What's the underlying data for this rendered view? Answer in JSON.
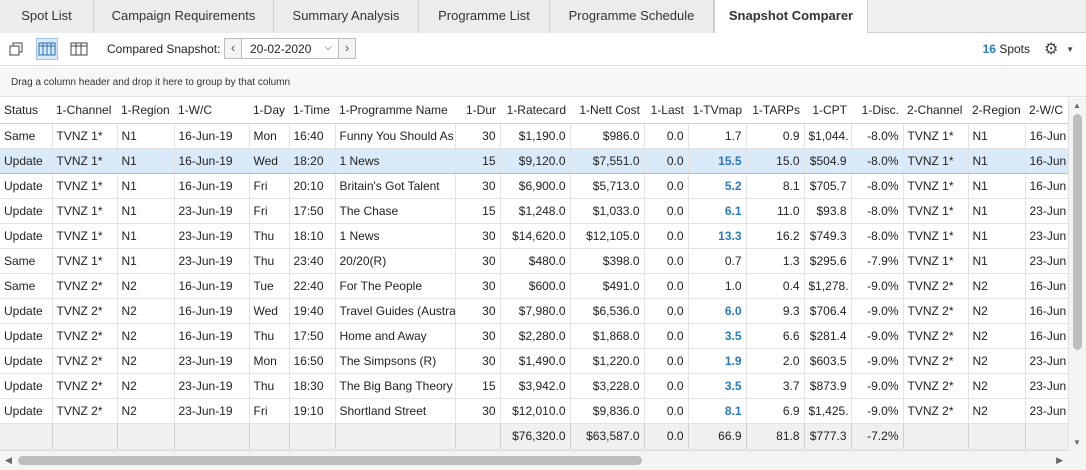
{
  "tabs": [
    {
      "label": "Spot List"
    },
    {
      "label": "Campaign Requirements"
    },
    {
      "label": "Summary Analysis"
    },
    {
      "label": "Programme List"
    },
    {
      "label": "Programme Schedule"
    },
    {
      "label": "Snapshot Comparer"
    }
  ],
  "toolbar": {
    "compared_label": "Compared Snapshot:",
    "snapshot_date": "20-02-2020",
    "spots_count": "16",
    "spots_label": "Spots"
  },
  "group_panel": {
    "hint": "Drag a column header and drop it here to group by that column"
  },
  "grid": {
    "columns": [
      "Status",
      "1-Channel",
      "1-Region",
      "1-W/C",
      "1-Day",
      "1-Time",
      "1-Programme Name",
      "1-Dur",
      "1-Ratecard",
      "1-Nett Cost",
      "1-Last",
      "1-TVmap",
      "1-TARPs",
      "1-CPT",
      "1-Disc.",
      "2-Channel",
      "2-Region",
      "2-W/C"
    ],
    "rows": [
      [
        "Same",
        "TVNZ 1*",
        "N1",
        "16-Jun-19",
        "Mon",
        "16:40",
        "Funny You Should As",
        "30",
        "$1,190.0",
        "$986.0",
        "0.0",
        "1.7",
        "0.9",
        "$1,044.",
        "-8.0%",
        "TVNZ 1*",
        "N1",
        "16-Jun"
      ],
      [
        "Update",
        "TVNZ 1*",
        "N1",
        "16-Jun-19",
        "Wed",
        "18:20",
        "1 News",
        "15",
        "$9,120.0",
        "$7,551.0",
        "0.0",
        "15.5",
        "15.0",
        "$504.9",
        "-8.0%",
        "TVNZ 1*",
        "N1",
        "16-Jun"
      ],
      [
        "Update",
        "TVNZ 1*",
        "N1",
        "16-Jun-19",
        "Fri",
        "20:10",
        "Britain's Got Talent",
        "30",
        "$6,900.0",
        "$5,713.0",
        "0.0",
        "5.2",
        "8.1",
        "$705.7",
        "-8.0%",
        "TVNZ 1*",
        "N1",
        "16-Jun"
      ],
      [
        "Update",
        "TVNZ 1*",
        "N1",
        "23-Jun-19",
        "Fri",
        "17:50",
        "The Chase",
        "15",
        "$1,248.0",
        "$1,033.0",
        "0.0",
        "6.1",
        "11.0",
        "$93.8",
        "-8.0%",
        "TVNZ 1*",
        "N1",
        "23-Jun"
      ],
      [
        "Update",
        "TVNZ 1*",
        "N1",
        "23-Jun-19",
        "Thu",
        "18:10",
        "1 News",
        "30",
        "$14,620.0",
        "$12,105.0",
        "0.0",
        "13.3",
        "16.2",
        "$749.3",
        "-8.0%",
        "TVNZ 1*",
        "N1",
        "23-Jun"
      ],
      [
        "Same",
        "TVNZ 1*",
        "N1",
        "23-Jun-19",
        "Thu",
        "23:40",
        "20/20(R)",
        "30",
        "$480.0",
        "$398.0",
        "0.0",
        "0.7",
        "1.3",
        "$295.6",
        "-7.9%",
        "TVNZ 1*",
        "N1",
        "23-Jun"
      ],
      [
        "Same",
        "TVNZ 2*",
        "N2",
        "16-Jun-19",
        "Tue",
        "22:40",
        "For The People",
        "30",
        "$600.0",
        "$491.0",
        "0.0",
        "1.0",
        "0.4",
        "$1,278.",
        "-9.0%",
        "TVNZ 2*",
        "N2",
        "16-Jun"
      ],
      [
        "Update",
        "TVNZ 2*",
        "N2",
        "16-Jun-19",
        "Wed",
        "19:40",
        "Travel Guides (Austra",
        "30",
        "$7,980.0",
        "$6,536.0",
        "0.0",
        "6.0",
        "9.3",
        "$706.4",
        "-9.0%",
        "TVNZ 2*",
        "N2",
        "16-Jun"
      ],
      [
        "Update",
        "TVNZ 2*",
        "N2",
        "16-Jun-19",
        "Thu",
        "17:50",
        "Home and Away",
        "30",
        "$2,280.0",
        "$1,868.0",
        "0.0",
        "3.5",
        "6.6",
        "$281.4",
        "-9.0%",
        "TVNZ 2*",
        "N2",
        "16-Jun"
      ],
      [
        "Update",
        "TVNZ 2*",
        "N2",
        "23-Jun-19",
        "Mon",
        "16:50",
        "The Simpsons (R)",
        "30",
        "$1,490.0",
        "$1,220.0",
        "0.0",
        "1.9",
        "2.0",
        "$603.5",
        "-9.0%",
        "TVNZ 2*",
        "N2",
        "23-Jun"
      ],
      [
        "Update",
        "TVNZ 2*",
        "N2",
        "23-Jun-19",
        "Thu",
        "18:30",
        "The Big Bang Theory",
        "15",
        "$3,942.0",
        "$3,228.0",
        "0.0",
        "3.5",
        "3.7",
        "$873.9",
        "-9.0%",
        "TVNZ 2*",
        "N2",
        "23-Jun"
      ],
      [
        "Update",
        "TVNZ 2*",
        "N2",
        "23-Jun-19",
        "Fri",
        "19:10",
        "Shortland Street",
        "30",
        "$12,010.0",
        "$9,836.0",
        "0.0",
        "8.1",
        "6.9",
        "$1,425.",
        "-9.0%",
        "TVNZ 2*",
        "N2",
        "23-Jun"
      ]
    ],
    "highlight_tvmap_rows": [
      1,
      2,
      3,
      4,
      7,
      8,
      9,
      10,
      11
    ],
    "selected_row": 1,
    "totals": [
      "",
      "",
      "",
      "",
      "",
      "",
      "",
      "",
      "$76,320.0",
      "$63,587.0",
      "0.0",
      "66.9",
      "81.8",
      "$777.3",
      "-7.2%",
      "",
      "",
      ""
    ]
  }
}
